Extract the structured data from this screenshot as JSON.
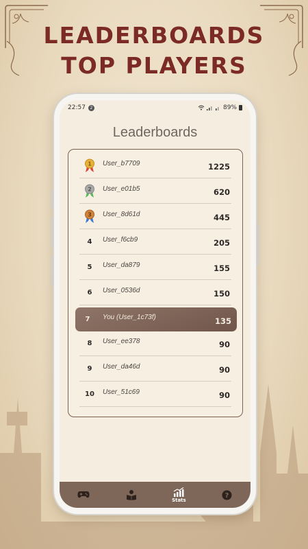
{
  "banner": {
    "line1": "LEADERBOARDS",
    "line2": "TOP PLAYERS"
  },
  "status": {
    "time": "22:57",
    "notif_count": "2",
    "battery": "89%"
  },
  "screen": {
    "title": "Leaderboards"
  },
  "leaderboard": [
    {
      "rank": "1",
      "medal": "gold-medal-icon",
      "name": "User_b7709",
      "score": "1225"
    },
    {
      "rank": "2",
      "medal": "silver-medal-icon",
      "name": "User_e01b5",
      "score": "620"
    },
    {
      "rank": "3",
      "medal": "bronze-medal-icon",
      "name": "User_8d61d",
      "score": "445"
    },
    {
      "rank": "4",
      "name": "User_f6cb9",
      "score": "205"
    },
    {
      "rank": "5",
      "name": "User_da879",
      "score": "155"
    },
    {
      "rank": "6",
      "name": "User_0536d",
      "score": "150"
    },
    {
      "rank": "7",
      "name": "You (User_1c73f)",
      "score": "135",
      "is_current_user": true
    },
    {
      "rank": "8",
      "name": "User_ee378",
      "score": "90"
    },
    {
      "rank": "9",
      "name": "User_da46d",
      "score": "90"
    },
    {
      "rank": "10",
      "name": "User_51c69",
      "score": "90"
    }
  ],
  "nav": {
    "stats_label": "Stats"
  },
  "colors": {
    "banner_text": "#7b2a26",
    "highlight_row": "#7d6356",
    "nav_bar": "#7e6759",
    "gold": "#e6b23a",
    "silver": "#a9a9a9",
    "bronze": "#d0843b"
  }
}
